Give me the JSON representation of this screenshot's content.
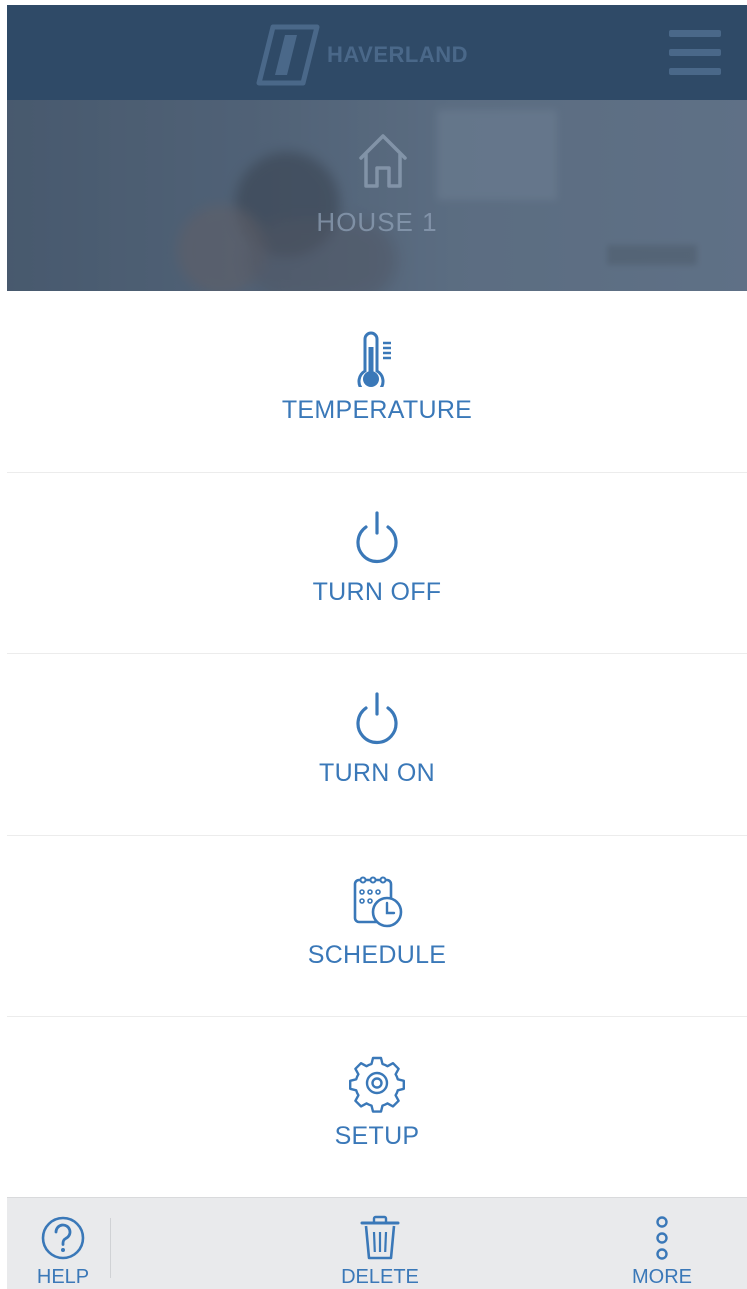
{
  "header": {
    "brand": "HAVERLAND",
    "menu_icon": "hamburger-menu-icon"
  },
  "hero": {
    "house_name": "HOUSE 1",
    "icon": "house-icon"
  },
  "menu": {
    "items": [
      {
        "label": "TEMPERATURE",
        "icon": "thermometer-icon"
      },
      {
        "label": "TURN OFF",
        "icon": "power-icon"
      },
      {
        "label": "TURN ON",
        "icon": "power-icon"
      },
      {
        "label": "SCHEDULE",
        "icon": "calendar-clock-icon"
      },
      {
        "label": "SETUP",
        "icon": "gear-icon"
      }
    ]
  },
  "footer": {
    "help_label": "HELP",
    "delete_label": "DELETE",
    "more_label": "MORE"
  },
  "colors": {
    "header_bg": "#2f4a67",
    "accent": "#3a78b8",
    "footer_bg": "#e9eaec"
  }
}
